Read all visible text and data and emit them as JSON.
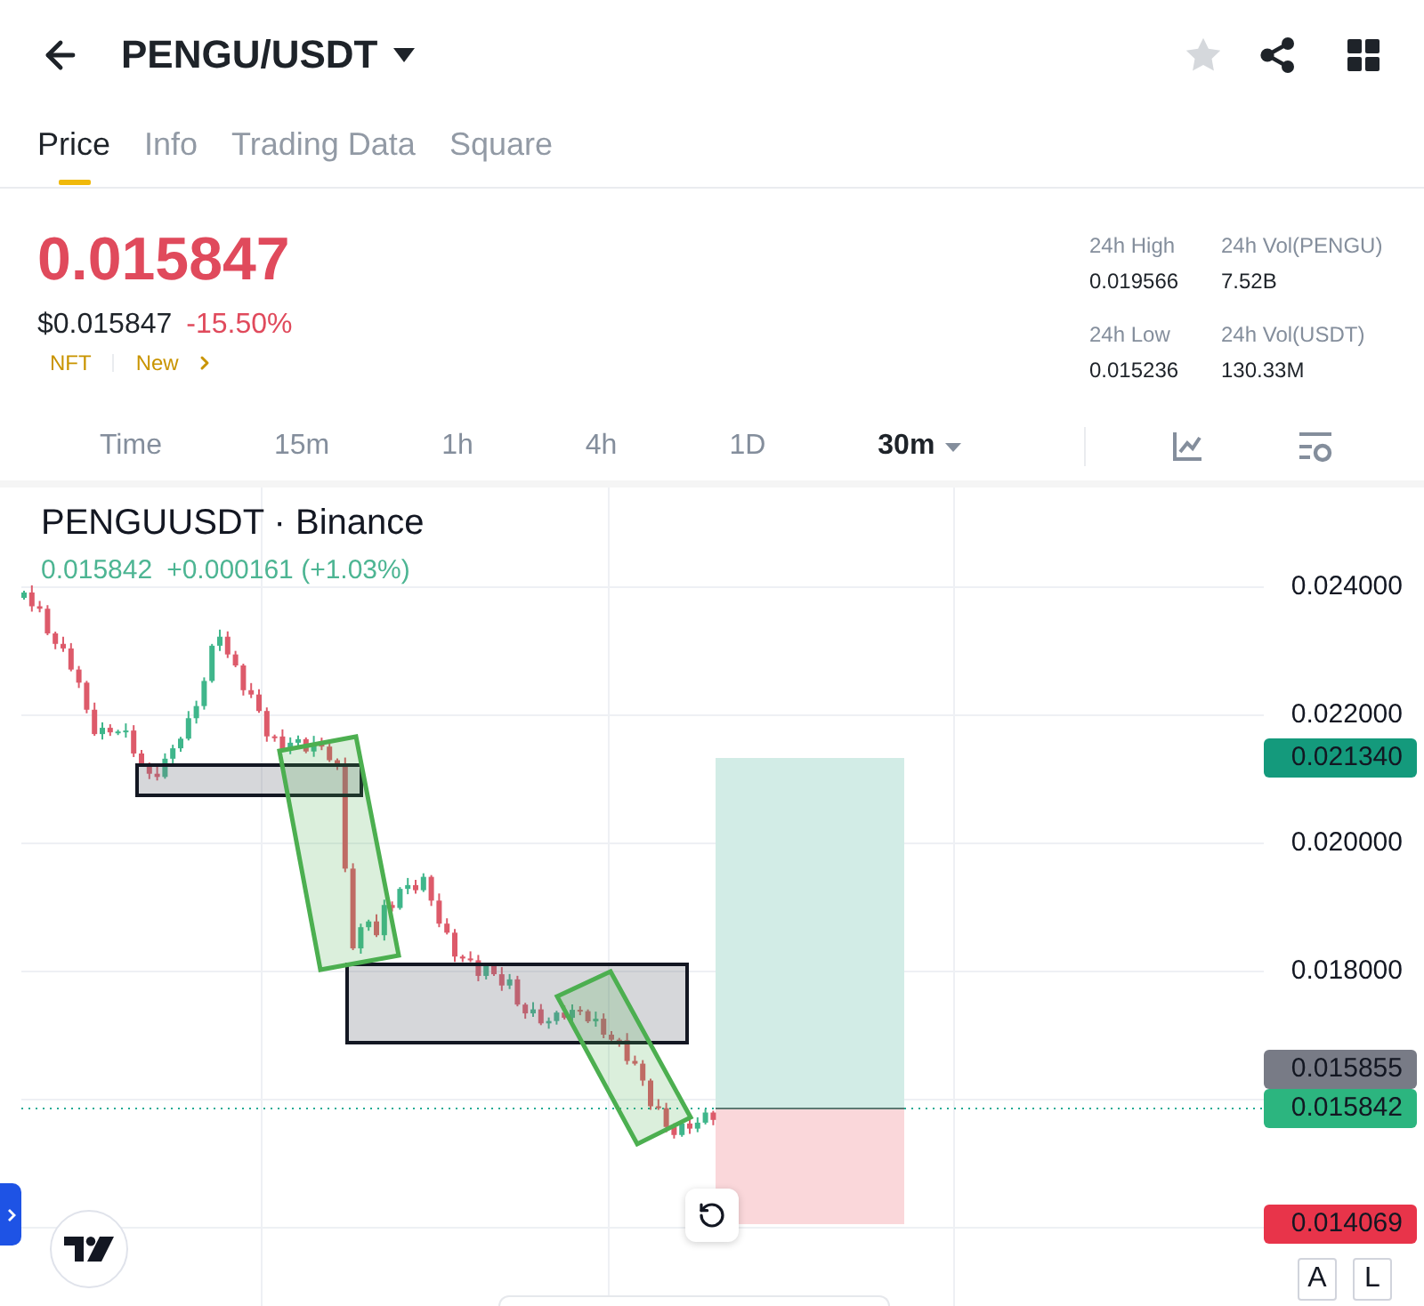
{
  "header": {
    "title": "PENGU/USDT",
    "favorite": false
  },
  "tabs": [
    {
      "label": "Price",
      "selected": true
    },
    {
      "label": "Info",
      "selected": false
    },
    {
      "label": "Trading Data",
      "selected": false
    },
    {
      "label": "Square",
      "selected": false
    }
  ],
  "price": {
    "last": "0.015847",
    "usd": "$0.015847",
    "change": "-15.50%",
    "tags": [
      "NFT",
      "New"
    ]
  },
  "stats": [
    {
      "label": "24h High",
      "value": "0.019566"
    },
    {
      "label": "24h Vol(PENGU)",
      "value": "7.52B"
    },
    {
      "label": "24h Low",
      "value": "0.015236"
    },
    {
      "label": "24h Vol(USDT)",
      "value": "130.33M"
    }
  ],
  "intervals": [
    {
      "label": "Time",
      "selected": false
    },
    {
      "label": "15m",
      "selected": false
    },
    {
      "label": "1h",
      "selected": false
    },
    {
      "label": "4h",
      "selected": false
    },
    {
      "label": "1D",
      "selected": false
    },
    {
      "label": "30m",
      "selected": true
    }
  ],
  "chart": {
    "symbol": "PENGUUSDT · Binance",
    "last": "0.015842",
    "change": "+0.000161 (+1.03%)",
    "axis_labels": [
      "0.024000",
      "0.022000",
      "0.020000",
      "0.018000"
    ],
    "price_tags": [
      {
        "value": "0.021340",
        "color": "#149a7c"
      },
      {
        "value": "0.015855",
        "color": "#787b86"
      },
      {
        "value": "0.015842",
        "color": "#2cb57f"
      },
      {
        "value": "0.014069",
        "color": "#e8344a"
      }
    ],
    "scale_buttons": [
      "A",
      "L"
    ]
  }
}
